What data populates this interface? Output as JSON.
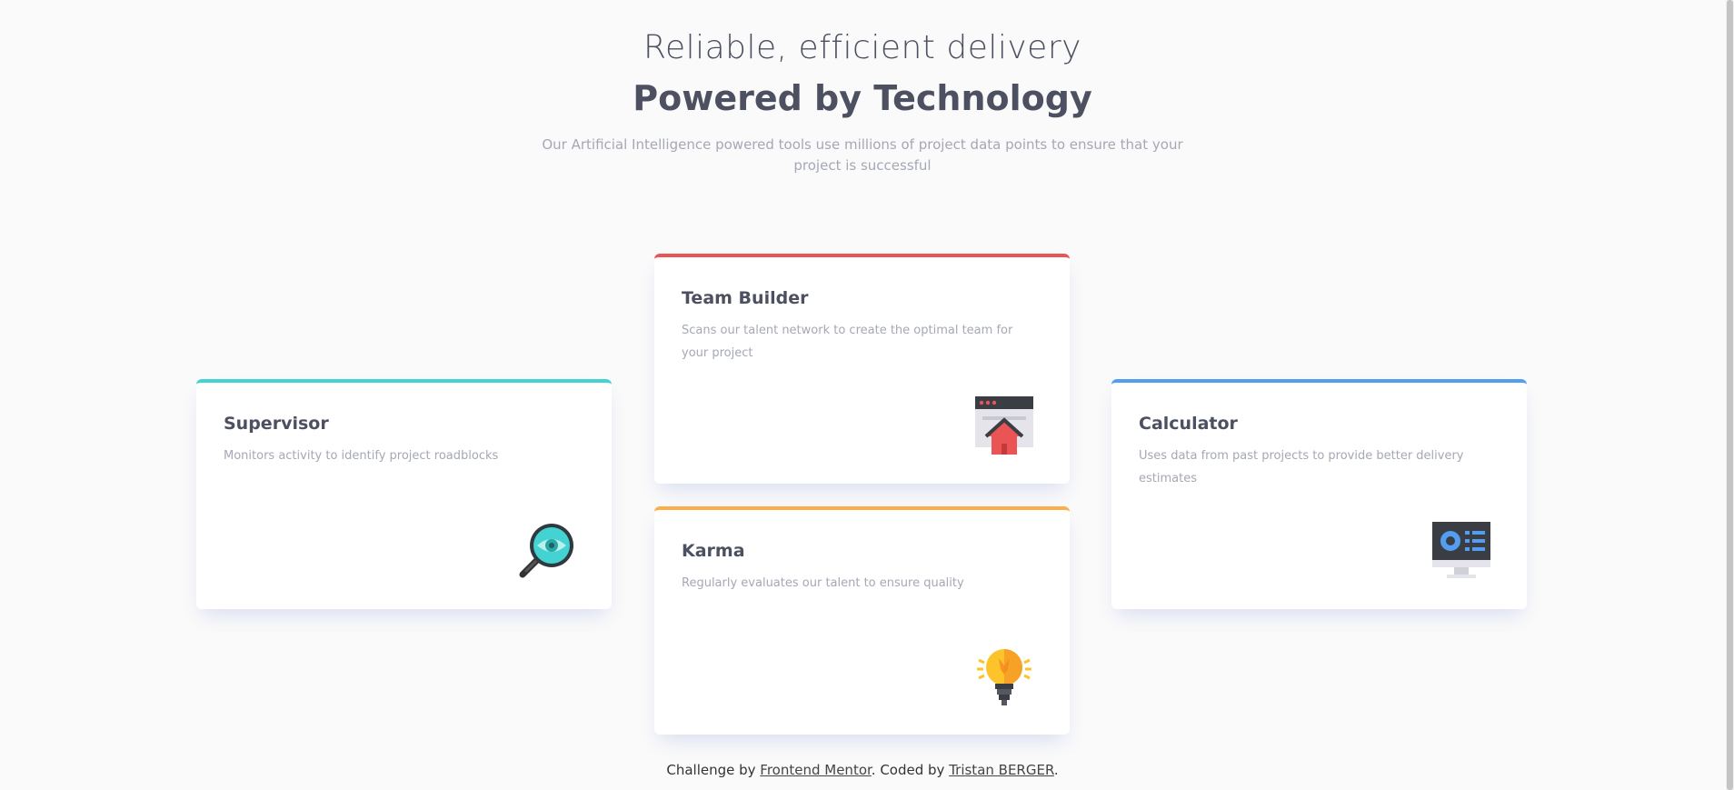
{
  "header": {
    "title_light": "Reliable, efficient delivery",
    "title_bold": "Powered by Technology",
    "description": "Our Artificial Intelligence powered tools use millions of project data points to ensure that your project is successful"
  },
  "cards": [
    {
      "title": "Supervisor",
      "text": "Monitors activity to identify project roadblocks",
      "icon": "magnifier-eye-icon",
      "accent": "#44d3d2"
    },
    {
      "title": "Team Builder",
      "text": "Scans our talent network to create the optimal team for your project",
      "icon": "browser-house-icon",
      "accent": "#ea5454"
    },
    {
      "title": "Karma",
      "text": "Regularly evaluates our talent to ensure quality",
      "icon": "lightbulb-icon",
      "accent": "#fcae4a"
    },
    {
      "title": "Calculator",
      "text": "Uses data from past projects to provide better delivery estimates",
      "icon": "monitor-chart-icon",
      "accent": "#549ef2"
    }
  ],
  "footer": {
    "prefix": "Challenge by ",
    "link1": "Frontend Mentor",
    "middle": ". Coded by ",
    "link2": "Tristan BERGER",
    "suffix": "."
  }
}
